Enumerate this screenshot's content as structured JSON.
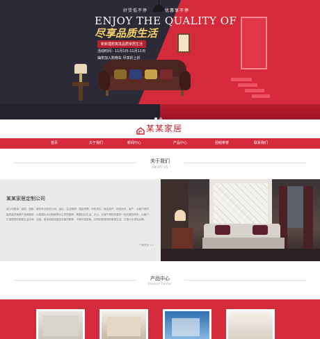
{
  "banner": {
    "tag_left": "好货低不停",
    "tag_right": "优惠享不停",
    "headline": "ENJOY THE QUALITY OF LIFE",
    "subheadline": "尽享品质生活",
    "pill": "新新理想真境品质家居生活",
    "date_line": "活动时间：11月1日-11月11日",
    "offer_line": "抽奖加入购物车  尽享折上折",
    "slide_count": 2,
    "active_slide": 1
  },
  "logo": {
    "text": "某某家居",
    "icon": "house-logo-icon",
    "color": "#c8202f"
  },
  "nav": {
    "items": [
      {
        "label": "首页"
      },
      {
        "label": "关于我们"
      },
      {
        "label": "新闻中心"
      },
      {
        "label": "产品中心"
      },
      {
        "label": "团组荣誉"
      },
      {
        "label": "联系我们"
      }
    ],
    "bg_color": "#d52a3b"
  },
  "about": {
    "title": "关于我们",
    "subtitle": "ABOUT US",
    "company": "某某家居定制公司",
    "body": "我公司整体：诚信、创新、服务专业化的公司，诚实、企业精神：团结拼搏、开拓求实、唯实而严、科技优先，客户，为客户提供高质量的家具产品和服务，以高端实木定制家具为主导的整体，覆盖社区生活、办公、为客户提供完善的一站式服务体系，为客户打造理想的家居生活空间、加强、追求卓越及团结互助的精神，不断开拓进取，共同创造美好的家居生活，打造行业领先品牌。",
    "more": "了解更多 >>"
  },
  "products": {
    "title": "产品中心",
    "subtitle": "Product Center"
  }
}
